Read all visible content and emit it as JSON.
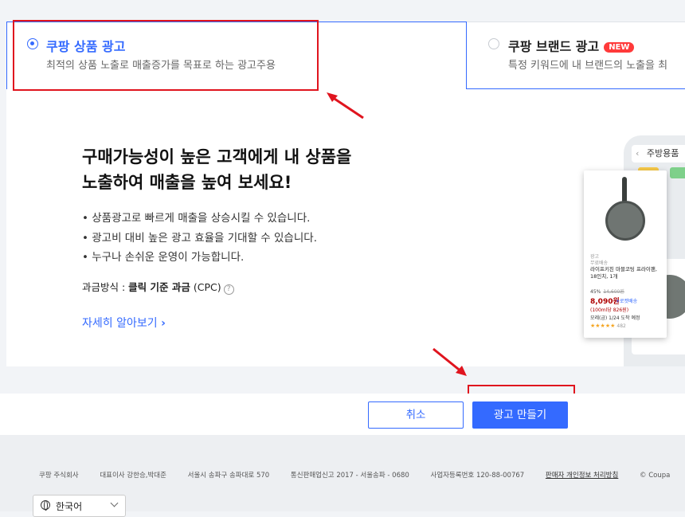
{
  "tabs": [
    {
      "title": "쿠팡 상품 광고",
      "description": "최적의 상품 노출로 매출증가를 목표로 하는 광고주용",
      "selected": true
    },
    {
      "title": "쿠팡 브랜드 광고",
      "badge": "NEW",
      "description": "특정 키워드에 내 브랜드의 노출을 최",
      "selected": false
    }
  ],
  "main": {
    "headline_line1": "구매가능성이 높은 고객에게 내 상품을",
    "headline_line2": "노출하여 매출을 높여 보세요!",
    "bullets": [
      "• 상품광고로 빠르게 매출을 상승시킬 수 있습니다.",
      "• 광고비 대비 높은 광고 효율을 기대할 수 있습니다.",
      "• 누구나 손쉬운 운영이 가능합니다."
    ],
    "billing_label": "과금방식 : ",
    "billing_value": "클릭 기준 과금",
    "billing_suffix": " (CPC)",
    "help_icon": "?",
    "more_link": "자세히 알아보기",
    "more_chevron": "›"
  },
  "illustration": {
    "search_text": "주방용품",
    "ad_label": "광고",
    "shipping_label": "무료배송",
    "product_name": "라이프키친 마블코팅 프라이팬, 18인치, 1개",
    "discount": "45%",
    "original_price": "14,600원",
    "price": "8,090원",
    "rocket": "로켓배송",
    "unit_price": "(100ml당 826원)",
    "arrival": "모레(금) 1/24 도착 예정",
    "stars": "★★★★★",
    "review_count": "482"
  },
  "buttons": {
    "cancel": "취소",
    "create": "광고 만들기"
  },
  "footer": {
    "company": "쿠팡 주식회사",
    "ceo": "대표이사 강한승,박대준",
    "address": "서울시 송파구 송파대로 570",
    "telecom": "통신판매업신고 2017 - 서울송파 - 0680",
    "biz_number": "사업자등록번호 120-88-00767",
    "privacy": "판매자 개인정보 처리방침",
    "copyright": "© Coupa",
    "language": "한국어"
  },
  "colors": {
    "accent": "#346aff",
    "highlight": "#e0141e",
    "badge": "#ff3a3a"
  }
}
